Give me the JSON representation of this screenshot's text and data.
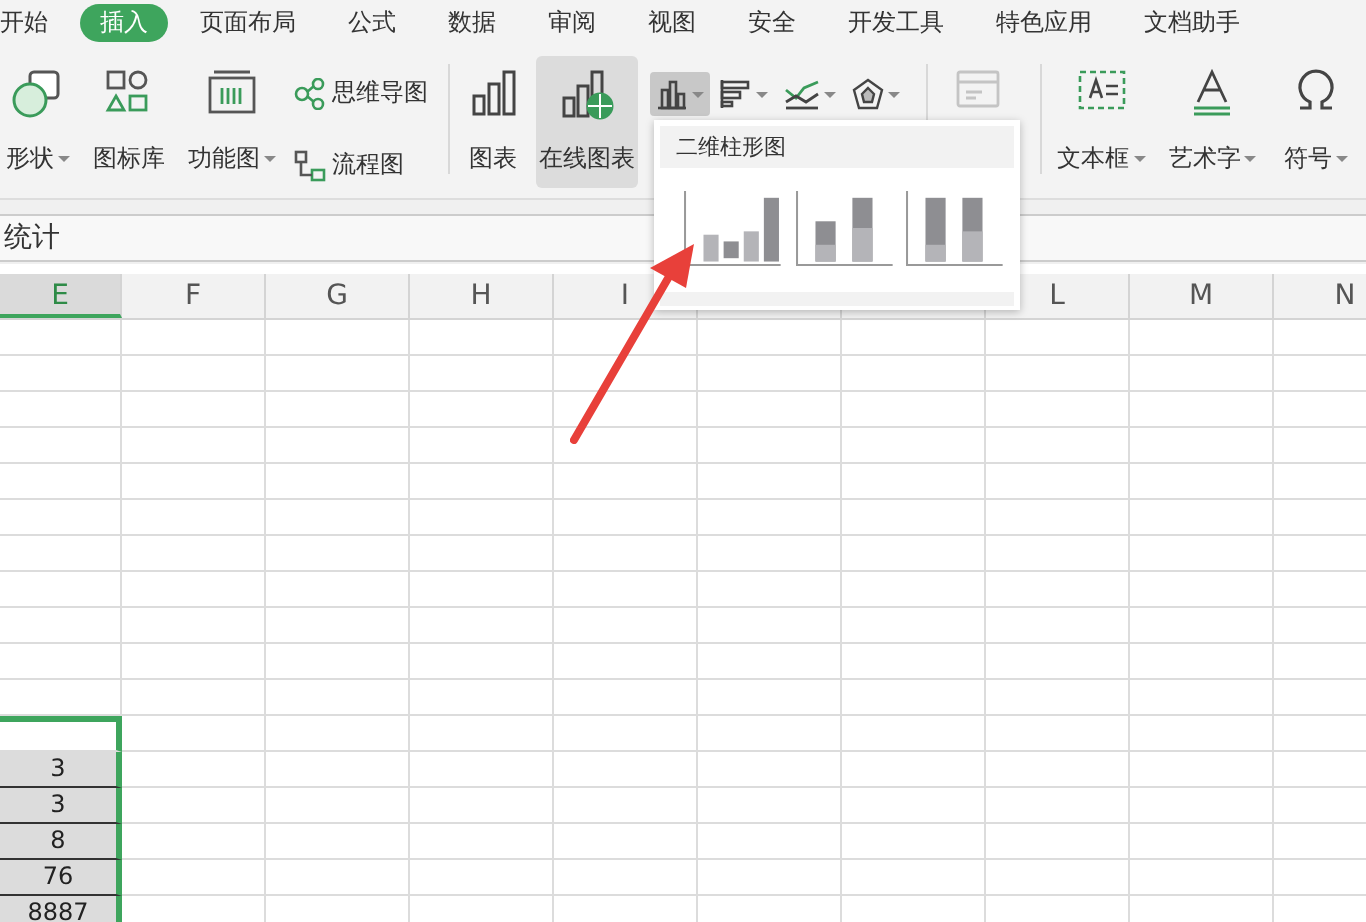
{
  "menu_tabs": [
    {
      "label": "开始",
      "selected": false
    },
    {
      "label": "插入",
      "selected": true
    },
    {
      "label": "页面布局",
      "selected": false
    },
    {
      "label": "公式",
      "selected": false
    },
    {
      "label": "数据",
      "selected": false
    },
    {
      "label": "审阅",
      "selected": false
    },
    {
      "label": "视图",
      "selected": false
    },
    {
      "label": "安全",
      "selected": false
    },
    {
      "label": "开发工具",
      "selected": false
    },
    {
      "label": "特色应用",
      "selected": false
    },
    {
      "label": "文档助手",
      "selected": false
    }
  ],
  "ribbon": {
    "shapes": {
      "label": "形状"
    },
    "icon_library": {
      "label": "图标库"
    },
    "function_chart": {
      "label": "功能图"
    },
    "mind_map": {
      "label": "思维导图"
    },
    "flowchart": {
      "label": "流程图"
    },
    "chart": {
      "label": "图表"
    },
    "online_chart": {
      "label": "在线图表",
      "selected": true
    },
    "chart_type_buttons": [
      {
        "kind": "column",
        "selected": true
      },
      {
        "kind": "bar",
        "selected": false
      },
      {
        "kind": "line",
        "selected": false
      },
      {
        "kind": "radar",
        "selected": false
      }
    ],
    "text_box": {
      "label": "文本框"
    },
    "word_art": {
      "label": "艺术字"
    },
    "symbol": {
      "label": "符号"
    }
  },
  "formula_bar": {
    "content": "统计"
  },
  "columns": [
    {
      "label": "E",
      "selected": true
    },
    {
      "label": "F",
      "selected": false
    },
    {
      "label": "G",
      "selected": false
    },
    {
      "label": "H",
      "selected": false
    },
    {
      "label": "I",
      "selected": false
    },
    {
      "selected": false
    },
    {
      "selected": false
    },
    {
      "label": "L",
      "selected": false
    },
    {
      "label": "M",
      "selected": false
    },
    {
      "label": "N",
      "selected": false
    }
  ],
  "column_e_cells": [
    {
      "selected": false
    },
    {
      "selected": false
    },
    {
      "selected": false
    },
    {
      "selected": false
    },
    {
      "selected": false
    },
    {
      "selected": false
    },
    {
      "selected": false
    },
    {
      "selected": false
    },
    {
      "selected": false
    },
    {
      "selected": false
    },
    {
      "selected": false
    },
    {
      "selected": true,
      "active": true
    },
    {
      "selected": true,
      "value": "3"
    },
    {
      "selected": true,
      "value": "3"
    },
    {
      "selected": true,
      "value": "8"
    },
    {
      "selected": true,
      "value": "76"
    },
    {
      "selected": true,
      "value": "8887"
    }
  ],
  "chart_dropdown": {
    "title": "二维柱形图",
    "options": [
      {
        "kind": "clustered"
      },
      {
        "kind": "stacked"
      },
      {
        "kind": "percent_stacked"
      }
    ]
  }
}
